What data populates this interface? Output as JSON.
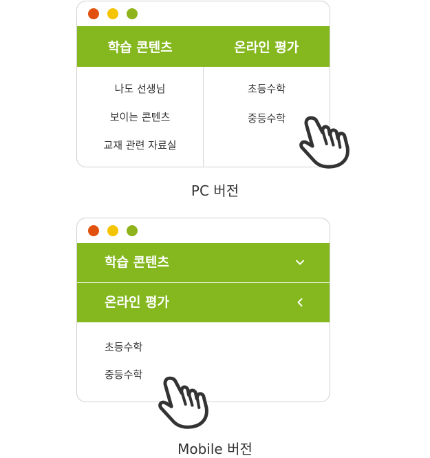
{
  "colors": {
    "accent": "#84b81e",
    "dot_red": "#e2500e",
    "dot_yellow": "#f5c400",
    "dot_green": "#8fb31c"
  },
  "pc": {
    "menus": [
      {
        "label": "학습 콘텐츠",
        "items": [
          "나도 선생님",
          "보이는 콘텐츠",
          "교재 관련 자료실"
        ]
      },
      {
        "label": "온라인 평가",
        "items": [
          "초등수학",
          "중등수학"
        ]
      }
    ],
    "caption": "PC 버전",
    "cursor_icon": "pointer-hand-icon"
  },
  "mobile": {
    "menus": [
      {
        "label": "학습 콘텐츠",
        "icon": "chevron-down-icon"
      },
      {
        "label": "온라인 평가",
        "icon": "chevron-left-icon"
      }
    ],
    "items": [
      "초등수학",
      "중등수학"
    ],
    "caption": "Mobile 버전",
    "cursor_icon": "pointer-hand-icon"
  }
}
